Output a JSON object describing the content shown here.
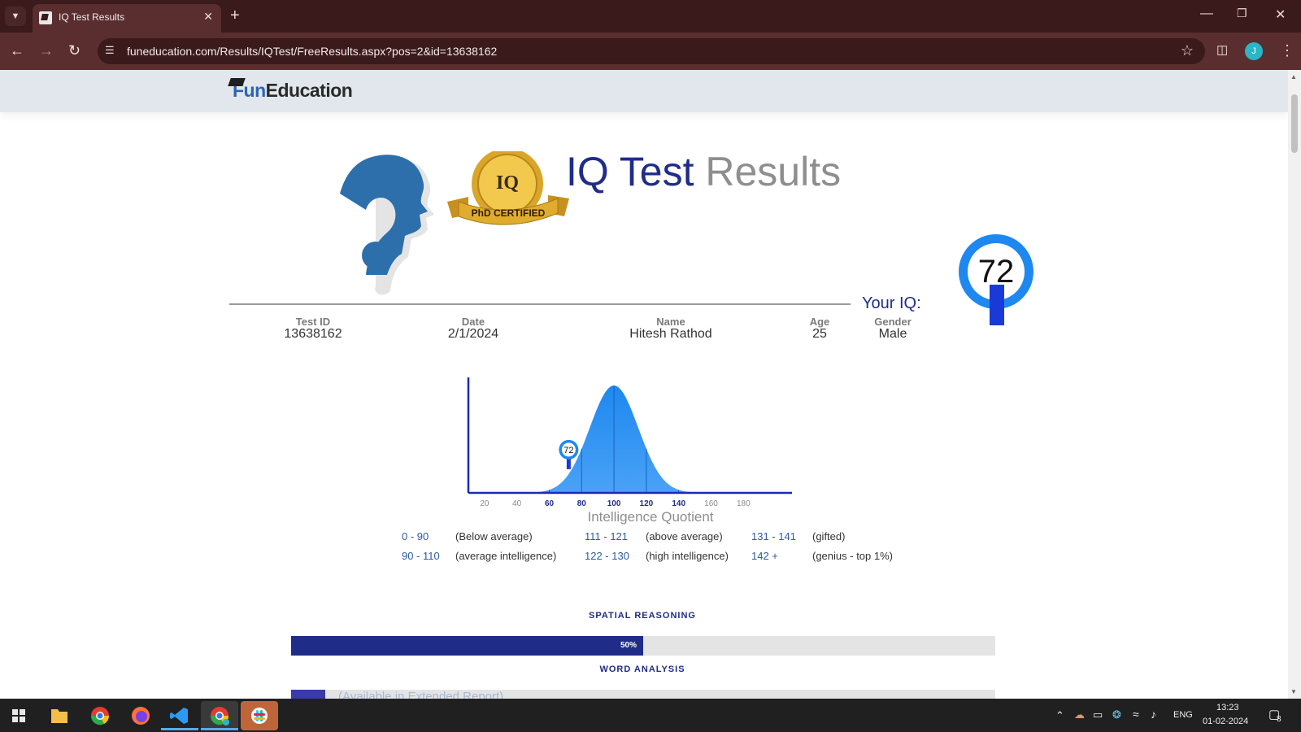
{
  "browser": {
    "tab_title": "IQ Test Results",
    "url": "funeducation.com/Results/IQTest/FreeResults.aspx?pos=2&id=13638162",
    "profile_initial": "J"
  },
  "header": {
    "logo_part1": "Fun",
    "logo_part2": "Education"
  },
  "badge_text": "PhD CERTIFIED",
  "title": {
    "part1": "IQ Test",
    "part2": "Results"
  },
  "your_iq_label": "Your IQ:",
  "iq_score": "72",
  "info": [
    {
      "label": "Test ID",
      "value": "13638162"
    },
    {
      "label": "Date",
      "value": "2/1/2024"
    },
    {
      "label": "Name",
      "value": "Hitesh Rathod"
    },
    {
      "label": "Age",
      "value": "25"
    },
    {
      "label": "Gender",
      "value": "Male"
    }
  ],
  "chart_data": {
    "type": "area",
    "title": "Intelligence Quotient",
    "x_ticks": [
      "20",
      "40",
      "60",
      "80",
      "100",
      "120",
      "140",
      "160",
      "180"
    ],
    "xlim": [
      10,
      210
    ],
    "distribution": {
      "mean": 100,
      "sd": 15
    },
    "marker": {
      "x": 72,
      "label": "72"
    },
    "highlight_ticks": [
      "60",
      "80",
      "100",
      "120",
      "140"
    ]
  },
  "legend": [
    {
      "range": "0 - 90",
      "desc": "(Below average)"
    },
    {
      "range": "90 - 110",
      "desc": "(average intelligence)"
    },
    {
      "range": "111 - 121",
      "desc": "(above average)"
    },
    {
      "range": "122 - 130",
      "desc": "(high intelligence)"
    },
    {
      "range": "131 - 141",
      "desc": "(gifted)"
    },
    {
      "range": "142 +",
      "desc": "(genius - top 1%)"
    }
  ],
  "sections": [
    {
      "label": "SPATIAL REASONING",
      "percent": 50,
      "percent_text": "50%"
    },
    {
      "label": "WORD ANALYSIS",
      "locked_text": "(Available in Extended Report)"
    }
  ],
  "taskbar": {
    "language": "ENG",
    "time": "13:23",
    "date": "01-02-2024",
    "notification_count": "8"
  },
  "colors": {
    "brand_navy": "#1f2c88",
    "accent_blue": "#1e88f0",
    "tab_bar": "#3a1a1a"
  }
}
